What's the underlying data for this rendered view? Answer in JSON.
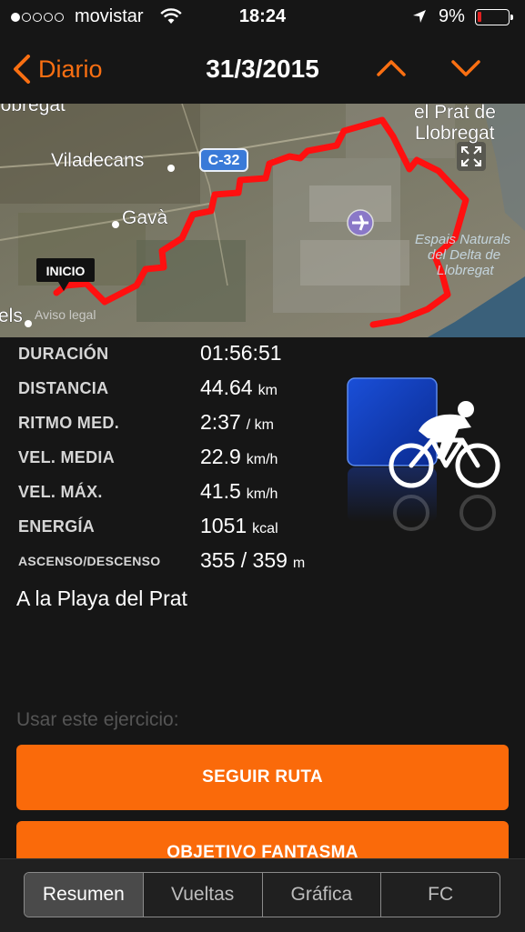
{
  "status_bar": {
    "signal_dots": [
      true,
      false,
      false,
      false,
      false
    ],
    "carrier": "movistar",
    "time": "18:24",
    "battery_percent": "9%",
    "battery_level": 0.09,
    "icons": [
      "wifi-icon",
      "location-arrow-icon",
      "battery-icon"
    ]
  },
  "nav": {
    "back_label": "Diario",
    "title": "31/3/2015",
    "icons": [
      "chevron-left-icon",
      "chevron-up-icon",
      "chevron-down-icon"
    ],
    "accent_color": "#f96f12"
  },
  "map": {
    "labels": {
      "llobregat_top": "lobregat",
      "viladecans": "Viladecans",
      "road": "C-32",
      "gava": "Gavà",
      "prat_line1": "el Prat de",
      "prat_line2": "Llobregat",
      "delta_line1": "Espais Naturals",
      "delta_line2": "del Delta de",
      "delta_line3": "Llobregat",
      "els": "els",
      "legal": "Aviso legal",
      "start_pin": "INICIO"
    },
    "route_color": "#ff1010",
    "icons": [
      "airport-icon",
      "expand-icon"
    ]
  },
  "stats": [
    {
      "label": "DURACIÓN",
      "value": "01:56:51",
      "unit": ""
    },
    {
      "label": "DISTANCIA",
      "value": "44.64",
      "unit": "km"
    },
    {
      "label": "RITMO MED.",
      "value": "2:37",
      "unit": "/ km"
    },
    {
      "label": "VEL. MEDIA",
      "value": "22.9",
      "unit": "km/h"
    },
    {
      "label": "VEL. MÁX.",
      "value": "41.5",
      "unit": "km/h"
    },
    {
      "label": "ENERGÍA",
      "value": "1051",
      "unit": "kcal"
    },
    {
      "label": "ASCENSO/DESCENSO",
      "value": "355 / 359",
      "unit": "m"
    }
  ],
  "activity_icon": "cycling-icon",
  "note": "A la Playa del Prat",
  "use_exercise_label": "Usar este ejercicio:",
  "buttons": {
    "follow_route": "SEGUIR RUTA",
    "ghost_target": "OBJETIVO FANTASMA"
  },
  "tabs": [
    {
      "label": "Resumen",
      "active": true
    },
    {
      "label": "Vueltas",
      "active": false
    },
    {
      "label": "Gráfica",
      "active": false
    },
    {
      "label": "FC",
      "active": false
    }
  ]
}
